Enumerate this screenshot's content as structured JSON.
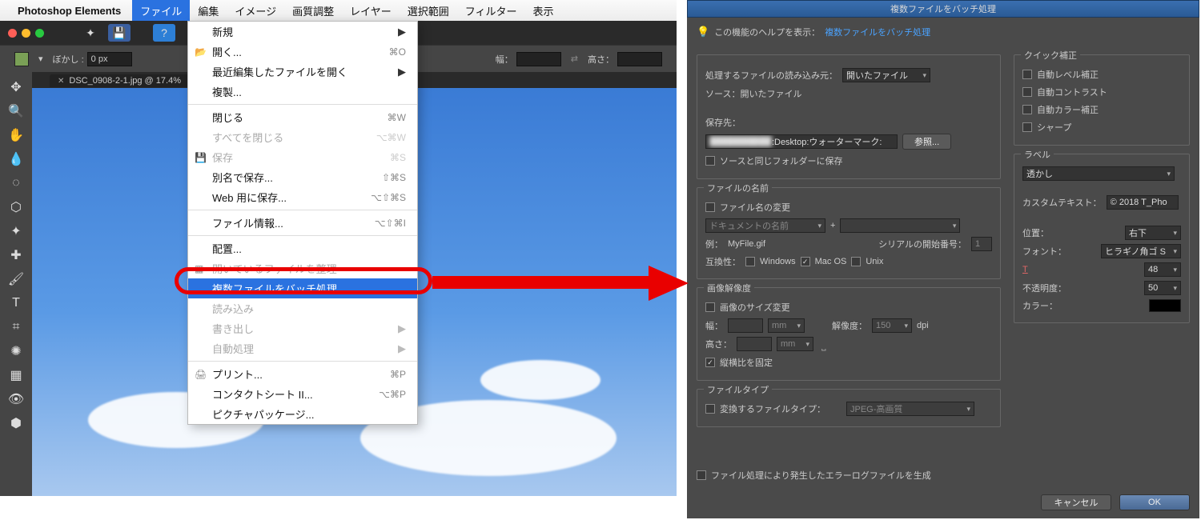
{
  "app": {
    "name": "Photoshop Elements"
  },
  "menus": [
    "ファイル",
    "編集",
    "イメージ",
    "画質調整",
    "レイヤー",
    "選択範囲",
    "フィルター",
    "表示"
  ],
  "optbar": {
    "bokashi": "ぼかし :",
    "bokashi_val": "0 px",
    "haba": "幅：",
    "takasa": "高さ："
  },
  "tab": {
    "title": "DSC_0908-2-1.jpg @ 17.4%"
  },
  "menu_items": [
    {
      "t": "sub",
      "label": "新規"
    },
    {
      "t": "item",
      "label": "開く...",
      "sc": "⌘O",
      "ico": "📂"
    },
    {
      "t": "sub",
      "label": "最近編集したファイルを開く"
    },
    {
      "t": "item",
      "label": "複製..."
    },
    {
      "t": "sep"
    },
    {
      "t": "item",
      "label": "閉じる",
      "sc": "⌘W"
    },
    {
      "t": "item",
      "label": "すべてを閉じる",
      "sc": "⌥⌘W",
      "dis": true
    },
    {
      "t": "item",
      "label": "保存",
      "sc": "⌘S",
      "dis": true,
      "ico": "💾"
    },
    {
      "t": "item",
      "label": "別名で保存...",
      "sc": "⇧⌘S"
    },
    {
      "t": "item",
      "label": "Web 用に保存...",
      "sc": "⌥⇧⌘S"
    },
    {
      "t": "sep"
    },
    {
      "t": "item",
      "label": "ファイル情報...",
      "sc": "⌥⇧⌘I"
    },
    {
      "t": "sep"
    },
    {
      "t": "item",
      "label": "配置..."
    },
    {
      "t": "item",
      "label": "開いているファイルを整理",
      "dis": true,
      "ico": "▦"
    },
    {
      "t": "item",
      "label": "複数ファイルをバッチ処理...",
      "hi": true
    },
    {
      "t": "item",
      "label": "読み込み",
      "dis": true
    },
    {
      "t": "sub",
      "label": "書き出し",
      "dis": true
    },
    {
      "t": "sub",
      "label": "自動処理",
      "dis": true
    },
    {
      "t": "sep"
    },
    {
      "t": "item",
      "label": "プリント...",
      "sc": "⌘P",
      "ico": "🖨"
    },
    {
      "t": "item",
      "label": "コンタクトシート II...",
      "sc": "⌥⌘P"
    },
    {
      "t": "item",
      "label": "ピクチャパッケージ..."
    }
  ],
  "dialog": {
    "title": "複数ファイルをバッチ処理",
    "help_pre": "この機能のヘルプを表示：",
    "help_link": "複数ファイルをバッチ処理",
    "proc_src": "処理するファイルの読み込み元：",
    "proc_src_val": "開いたファイル",
    "source_label": "ソース：開いたファイル",
    "save_label": "保存先：",
    "save_path_suffix": ":Desktop:ウォーターマーク:",
    "browse": "参照...",
    "same_folder": "ソースと同じフォルダーに保存",
    "fname_legend": "ファイルの名前",
    "fname_rename": "ファイル名の変更",
    "fname_dropdown": "ドキュメントの名前",
    "plus": "+",
    "example_l": "例：",
    "example": "MyFile.gif",
    "serial_l": "シリアルの開始番号：",
    "serial": "1",
    "compat": "互換性：",
    "win": "Windows",
    "mac": "Mac OS",
    "unix": "Unix",
    "res_legend": "画像解像度",
    "resize": "画像のサイズ変更",
    "w": "幅：",
    "h": "高さ：",
    "mm": "mm",
    "res_l": "解像度：",
    "res_v": "150",
    "dpi": "dpi",
    "constrain": "縦横比を固定",
    "ftype_legend": "ファイルタイプ",
    "ftype_convert": "変換するファイルタイプ：",
    "ftype_val": "JPEG-高画質",
    "errlog": "ファイル処理により発生したエラーログファイルを生成",
    "quick_legend": "クイック補正",
    "q1": "自動レベル補正",
    "q2": "自動コントラスト",
    "q3": "自動カラー補正",
    "q4": "シャープ",
    "lbl_legend": "ラベル",
    "lbl_dropdown": "透かし",
    "custom_l": "カスタムテキスト：",
    "custom": "© 2018 T_Pho",
    "pos_l": "位置：",
    "pos": "右下",
    "font_l": "フォント：",
    "font": "ヒラギノ角ゴ S",
    "size": "48",
    "opac_l": "不透明度：",
    "opac": "50",
    "color_l": "カラー：",
    "cancel": "キャンセル",
    "ok": "OK"
  }
}
